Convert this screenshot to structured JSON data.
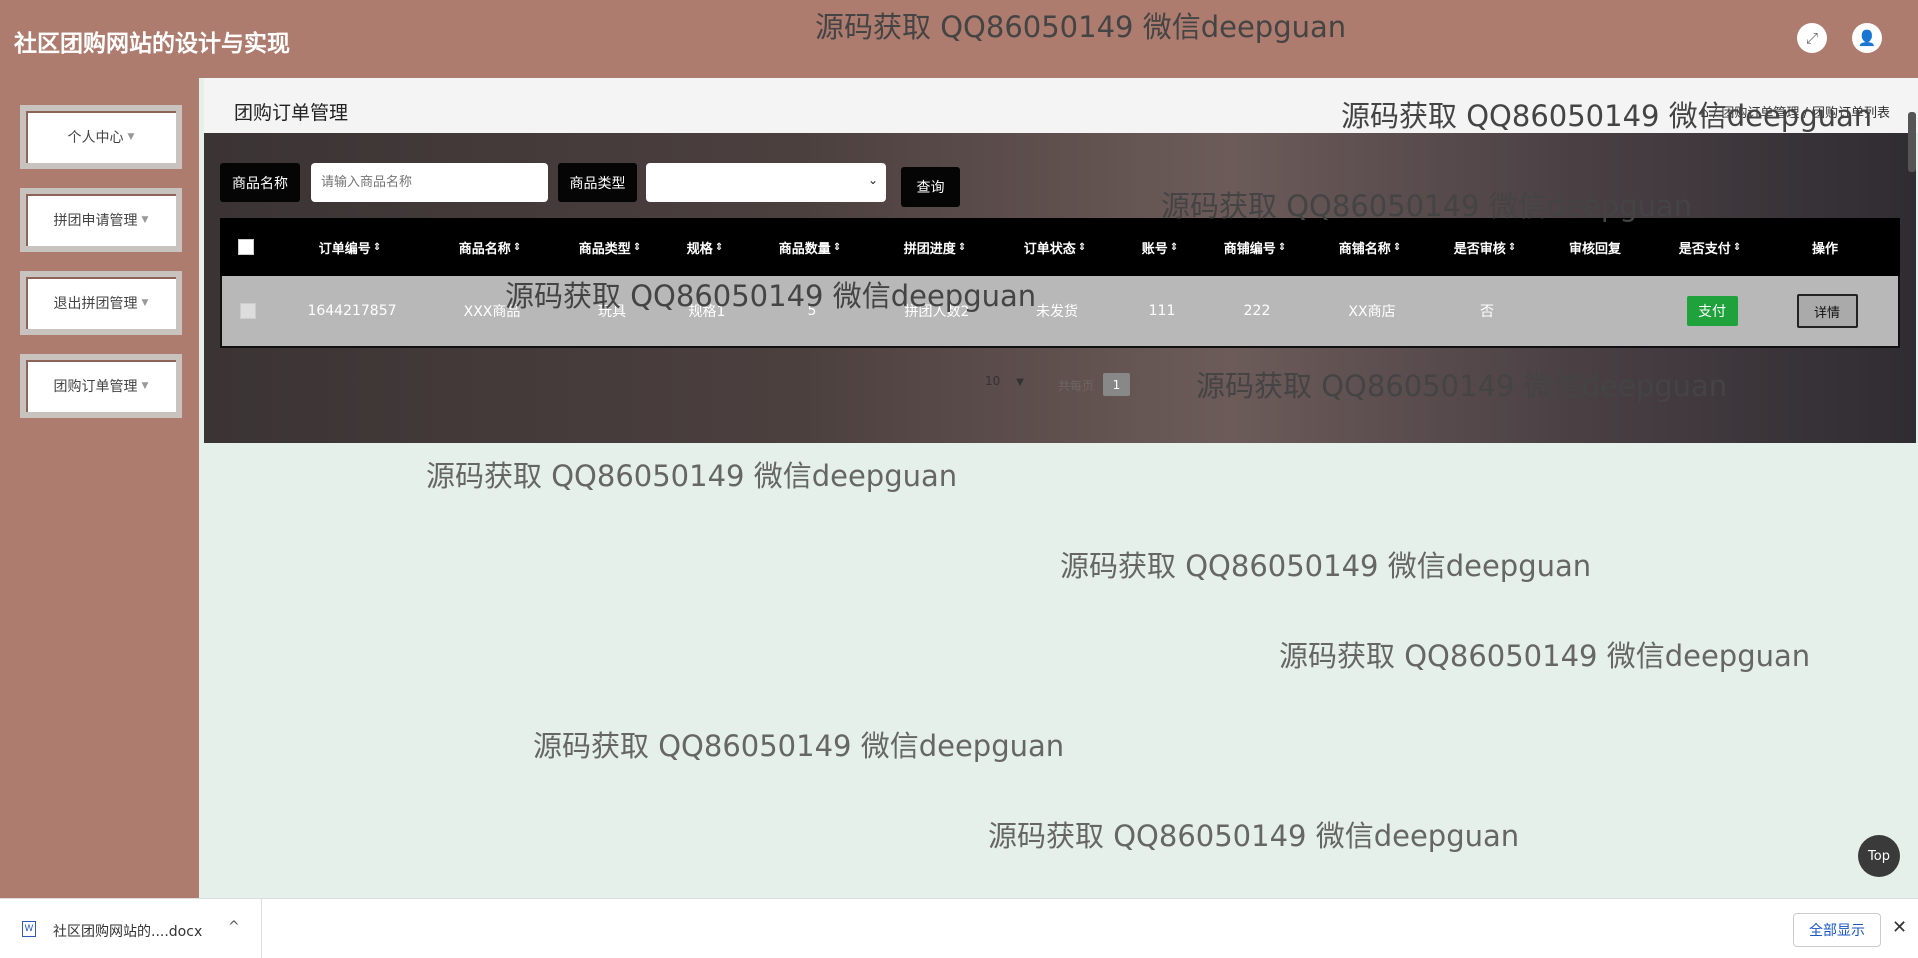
{
  "header": {
    "title": "社区团购网站的设计与实现",
    "fullscreen_icon": "⤢",
    "user_icon": "👤"
  },
  "sidebar": {
    "items": [
      {
        "label": "个人中心"
      },
      {
        "label": "拼团申请管理"
      },
      {
        "label": "退出拼团管理"
      },
      {
        "label": "团购订单管理"
      }
    ]
  },
  "page": {
    "title": "团购订单管理",
    "breadcrumb": "⌂ / 团购订单管理 / 团购订单列表"
  },
  "search": {
    "name_label": "商品名称",
    "name_placeholder": "请输入商品名称",
    "type_label": "商品类型",
    "type_selected": "",
    "query_label": "查询"
  },
  "table": {
    "columns": [
      "订单编号",
      "商品名称",
      "商品类型",
      "规格",
      "商品数量",
      "拼团进度",
      "订单状态",
      "账号",
      "商铺编号",
      "商铺名称",
      "是否审核",
      "审核回复",
      "是否支付",
      "操作"
    ],
    "rows": [
      {
        "order_no": "1644217857",
        "product_name": "XXX商品",
        "product_type": "玩具",
        "spec": "规格1",
        "quantity": "5",
        "progress": "拼团人数2",
        "status": "未发货",
        "account": "111",
        "shop_no": "222",
        "shop_name": "XX商店",
        "reviewed": "否",
        "review_reply": "",
        "pay_label": "支付",
        "detail_label": "详情"
      }
    ]
  },
  "pagination": {
    "page_size": "10",
    "info": "共每页",
    "current_page": "1"
  },
  "watermark": "源码获取 QQ86050149 微信deepguan",
  "top_button": "Top",
  "download_bar": {
    "file_name": "社区团购网站的....docx",
    "show_all": "全部显示",
    "close": "✕",
    "chevron": "^"
  },
  "colors": {
    "header_bg": "#ad7c6f",
    "sidebar_bg": "#ad7c6f",
    "page_bg": "#e6f0ea",
    "pay_green": "#1fa23c"
  }
}
